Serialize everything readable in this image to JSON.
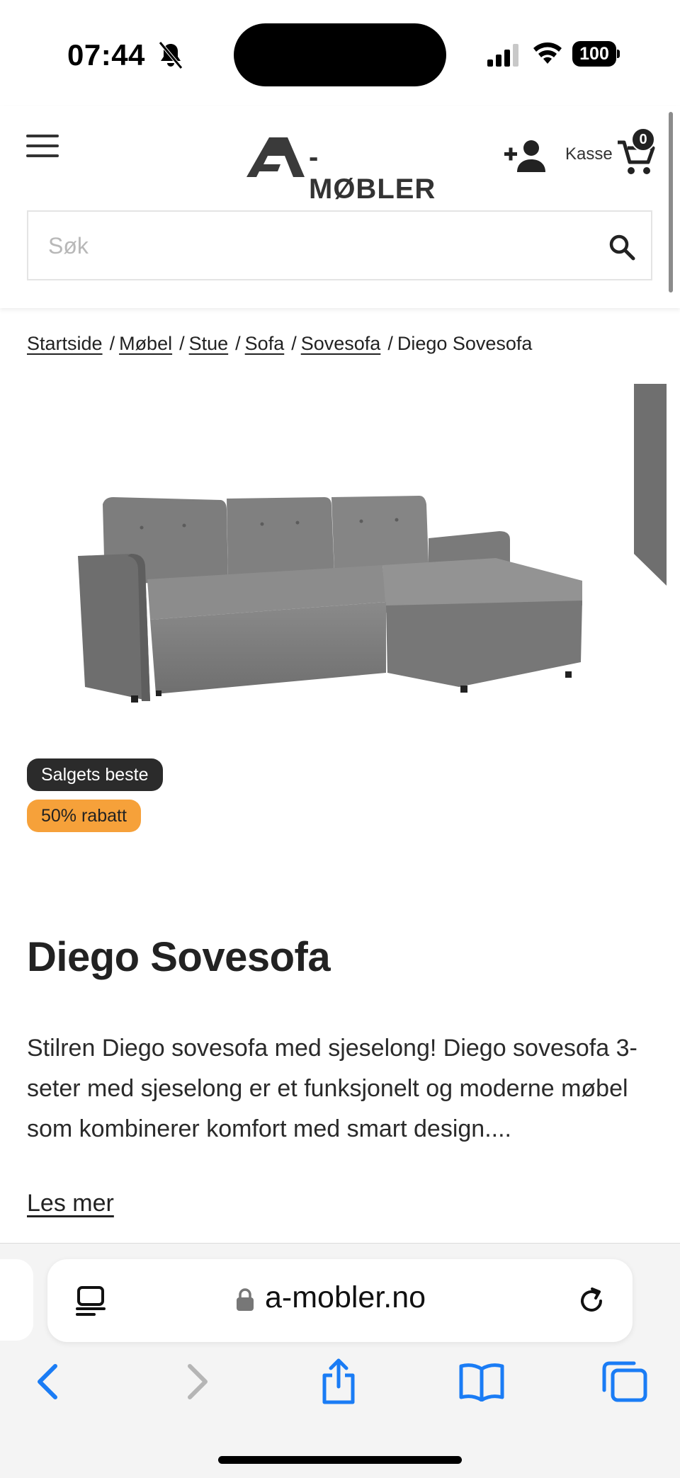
{
  "status_bar": {
    "time": "07:44",
    "battery": "100"
  },
  "header": {
    "logo_text": "-MØBLER",
    "checkout_label": "Kasse",
    "cart_count": "0",
    "search_placeholder": "Søk"
  },
  "breadcrumb": {
    "links": [
      "Startside",
      "Møbel",
      "Stue",
      "Sofa",
      "Sovesofa"
    ],
    "current": "Diego Sovesofa",
    "separator": "/"
  },
  "product": {
    "badges": {
      "bestseller": "Salgets beste",
      "discount": "50% rabatt"
    },
    "title": "Diego Sovesofa",
    "description": "Stilren Diego sovesofa med sjeselong! Diego sovesofa 3-seter med sjeselong er et funksjonelt og moderne møbel som kombinerer komfort med smart design....",
    "read_more": "Les mer"
  },
  "browser": {
    "url": "a-mobler.no"
  },
  "colors": {
    "accent_orange": "#f6a13a",
    "badge_dark": "#2b2b2b",
    "ios_blue": "#1a7cf5"
  },
  "icons": [
    "bell-slash-icon",
    "signal-icon",
    "wifi-icon",
    "menu-icon",
    "add-user-icon",
    "cart-icon",
    "search-icon",
    "reader-icon",
    "lock-icon",
    "reload-icon",
    "back-icon",
    "forward-icon",
    "share-icon",
    "bookmarks-icon",
    "tabs-icon"
  ]
}
